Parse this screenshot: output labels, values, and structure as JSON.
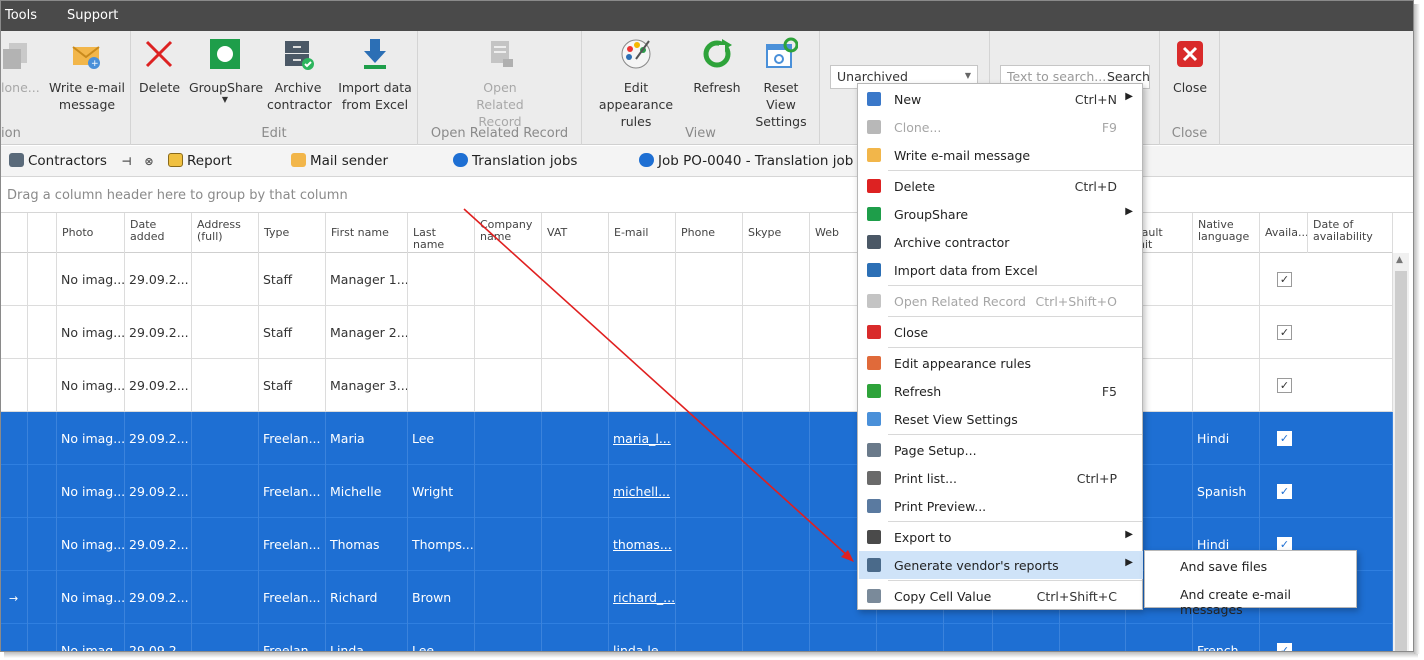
{
  "menubar": {
    "items": [
      "Tools",
      "Support"
    ]
  },
  "ribbon": {
    "groups": [
      {
        "label": "ion"
      },
      {
        "label": "Edit"
      },
      {
        "label": "Open Related Record"
      },
      {
        "label": "View"
      },
      {
        "label": "Close"
      }
    ],
    "buttons": {
      "clone": "Clone...",
      "write_email": "Write e-mail message",
      "delete": "Delete",
      "groupshare": "GroupShare",
      "archive": "Archive contractor",
      "import": "Import data from Excel",
      "open_related": "Open Related Record",
      "edit_appearance": "Edit appearance rules",
      "refresh": "Refresh",
      "reset_view": "Reset View Settings",
      "close": "Close"
    },
    "filter_value": "Unarchived",
    "search_placeholder": "Text to search...",
    "search_button": "Search"
  },
  "tabs": [
    "Contractors",
    "Report",
    "Mail sender",
    "Translation jobs",
    "Job PO-0040 - Translation job"
  ],
  "group_hint": "Drag a column header here to group by that column",
  "columns": [
    "Photo",
    "Date added",
    "Address (full)",
    "Type",
    "First name",
    "Last name",
    "Company name",
    "VAT",
    "E-mail",
    "Phone",
    "Skype",
    "Web",
    "efault unit",
    "Native language",
    "Availa...",
    "Date of availability"
  ],
  "rows": [
    {
      "photo": "No imag...",
      "date": "29.09.2...",
      "type": "Staff",
      "first": "Manager 1...",
      "last": "",
      "email": "",
      "lang": "",
      "selected": false
    },
    {
      "photo": "No imag...",
      "date": "29.09.2...",
      "type": "Staff",
      "first": "Manager 2...",
      "last": "",
      "email": "",
      "lang": "",
      "selected": false
    },
    {
      "photo": "No imag...",
      "date": "29.09.2...",
      "type": "Staff",
      "first": "Manager 3...",
      "last": "",
      "email": "",
      "lang": "",
      "selected": false
    },
    {
      "photo": "No imag...",
      "date": "29.09.2...",
      "type": "Freelan...",
      "first": "Maria",
      "last": "Lee",
      "email": "maria_l...",
      "lang": "Hindi",
      "selected": true
    },
    {
      "photo": "No imag...",
      "date": "29.09.2...",
      "type": "Freelan...",
      "first": "Michelle",
      "last": "Wright",
      "email": "michell...",
      "lang": "Spanish",
      "selected": true
    },
    {
      "photo": "No imag...",
      "date": "29.09.2...",
      "type": "Freelan...",
      "first": "Thomas",
      "last": "Thomps...",
      "email": "thomas...",
      "lang": "Hindi",
      "selected": true
    },
    {
      "photo": "No imag...",
      "date": "29.09.2...",
      "type": "Freelan...",
      "first": "Richard",
      "last": "Brown",
      "email": "richard_...",
      "lang": "",
      "selected": true
    },
    {
      "photo": "No imag...",
      "date": "29.09.2...",
      "type": "Freelan...",
      "first": "Linda",
      "last": "Lee",
      "email": "linda.le...",
      "lang": "French",
      "selected": true
    }
  ],
  "context_menu": [
    {
      "label": "New",
      "shortcut": "Ctrl+N",
      "submenu": true,
      "disabled": false
    },
    {
      "label": "Clone...",
      "shortcut": "F9",
      "submenu": false,
      "disabled": true
    },
    {
      "label": "Write e-mail message",
      "shortcut": "",
      "submenu": false,
      "disabled": false
    },
    {
      "label": "Delete",
      "shortcut": "Ctrl+D",
      "submenu": false,
      "disabled": false
    },
    {
      "label": "GroupShare",
      "shortcut": "",
      "submenu": true,
      "disabled": false
    },
    {
      "label": "Archive contractor",
      "shortcut": "",
      "submenu": false,
      "disabled": false
    },
    {
      "label": "Import data from Excel",
      "shortcut": "",
      "submenu": false,
      "disabled": false
    },
    {
      "label": "Open Related Record",
      "shortcut": "Ctrl+Shift+O",
      "submenu": false,
      "disabled": true
    },
    {
      "label": "Close",
      "shortcut": "",
      "submenu": false,
      "disabled": false
    },
    {
      "label": "Edit appearance rules",
      "shortcut": "",
      "submenu": false,
      "disabled": false
    },
    {
      "label": "Refresh",
      "shortcut": "F5",
      "submenu": false,
      "disabled": false
    },
    {
      "label": "Reset View Settings",
      "shortcut": "",
      "submenu": false,
      "disabled": false
    },
    {
      "label": "Page Setup...",
      "shortcut": "",
      "submenu": false,
      "disabled": false
    },
    {
      "label": "Print list...",
      "shortcut": "Ctrl+P",
      "submenu": false,
      "disabled": false
    },
    {
      "label": "Print Preview...",
      "shortcut": "",
      "submenu": false,
      "disabled": false
    },
    {
      "label": "Export to",
      "shortcut": "",
      "submenu": true,
      "disabled": false
    },
    {
      "label": "Generate vendor's reports",
      "shortcut": "",
      "submenu": true,
      "disabled": false
    },
    {
      "label": "Copy Cell Value",
      "shortcut": "Ctrl+Shift+C",
      "submenu": false,
      "disabled": false
    }
  ],
  "submenu": [
    "And save files",
    "And create e-mail messages"
  ],
  "colors": {
    "selection": "#1e6fd3",
    "highlight": "#cfe3f8",
    "arrow": "#e02020"
  }
}
